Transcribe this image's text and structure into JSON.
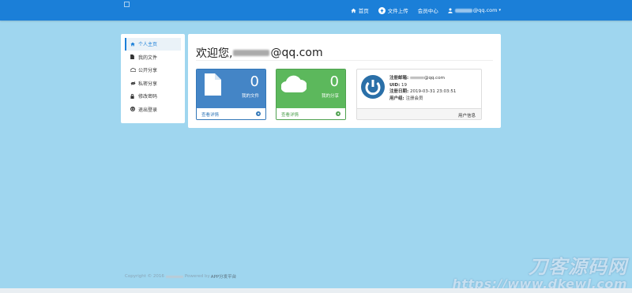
{
  "nav": {
    "home": "首页",
    "upload": "文件上传",
    "member": "会员中心",
    "email_suffix": "@qq.com"
  },
  "sidebar": {
    "items": [
      {
        "label": "个人主页",
        "icon": "home-icon"
      },
      {
        "label": "我的文件",
        "icon": "file-icon"
      },
      {
        "label": "公开分享",
        "icon": "cloud-icon"
      },
      {
        "label": "私密分享",
        "icon": "eye-slash-icon"
      },
      {
        "label": "修改密码",
        "icon": "lock-icon"
      },
      {
        "label": "退出登录",
        "icon": "power-icon"
      }
    ]
  },
  "main": {
    "welcome_prefix": "欢迎您,",
    "welcome_suffix": "@qq.com",
    "files_card": {
      "count": "0",
      "label": "我的文件",
      "link": "查看详情"
    },
    "share_card": {
      "count": "0",
      "label": "我的分享",
      "link": "查看详情"
    },
    "user_card": {
      "email_key": "注册邮箱:",
      "email_suffix": "@qq.com",
      "uid_key": "UID:",
      "uid_value": "19",
      "date_key": "注册日期:",
      "date_value": "2019-03-31 23:03:51",
      "group_key": "用户组:",
      "group_value": "注册会员",
      "footer": "用户信息"
    }
  },
  "footer": {
    "copyright": "Copyright © 2016",
    "powered": "Powered by",
    "platform": "APP分发平台"
  },
  "watermark": {
    "line1": "刀客源码网",
    "line2": "https://www.dkewl.com"
  },
  "colors": {
    "navbar": "#1b7fd8",
    "background": "#9fd6ef",
    "blue_card": "#4485c6",
    "green_card": "#5cb85c",
    "power_icon": "#2a6fa8"
  }
}
